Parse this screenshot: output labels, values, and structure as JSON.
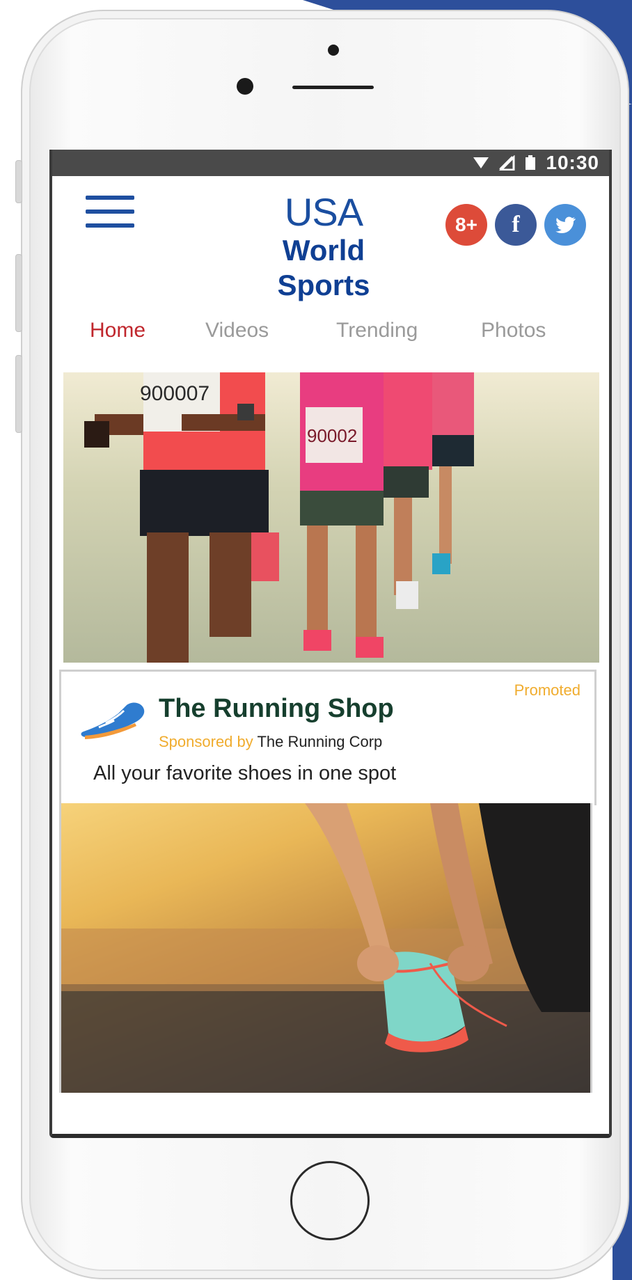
{
  "statusbar": {
    "icons": [
      "wifi-icon",
      "no-sim-icon",
      "battery-icon"
    ],
    "time": "10:30"
  },
  "header": {
    "logo_line1": "USA",
    "logo_line2": "World",
    "logo_line3": "Sports",
    "social": [
      {
        "icon": "google-plus-icon",
        "glyph": "8+",
        "color": "#dd4b39"
      },
      {
        "icon": "facebook-icon",
        "glyph": "f",
        "color": "#3b5998"
      },
      {
        "icon": "twitter-icon",
        "glyph": "t",
        "color": "#4a90d9"
      }
    ]
  },
  "tabs": [
    {
      "label": "Home",
      "active": true
    },
    {
      "label": "Videos",
      "active": false
    },
    {
      "label": "Trending",
      "active": false
    },
    {
      "label": "Photos",
      "active": false
    }
  ],
  "hero": {
    "bib_numbers": [
      "900007",
      "90002"
    ]
  },
  "ad": {
    "promoted_label": "Promoted",
    "title": "The Running Shop",
    "sponsor_prefix": "Sponsored by",
    "sponsor_name": "The Running Corp",
    "description": "All your favorite shoes in one spot"
  },
  "colors": {
    "brand_blue": "#1a4ea0",
    "active_tab": "#c0272d",
    "inactive_tab": "#9a9a9a",
    "promoted": "#f0ac2e",
    "ad_title": "#163f2e"
  }
}
